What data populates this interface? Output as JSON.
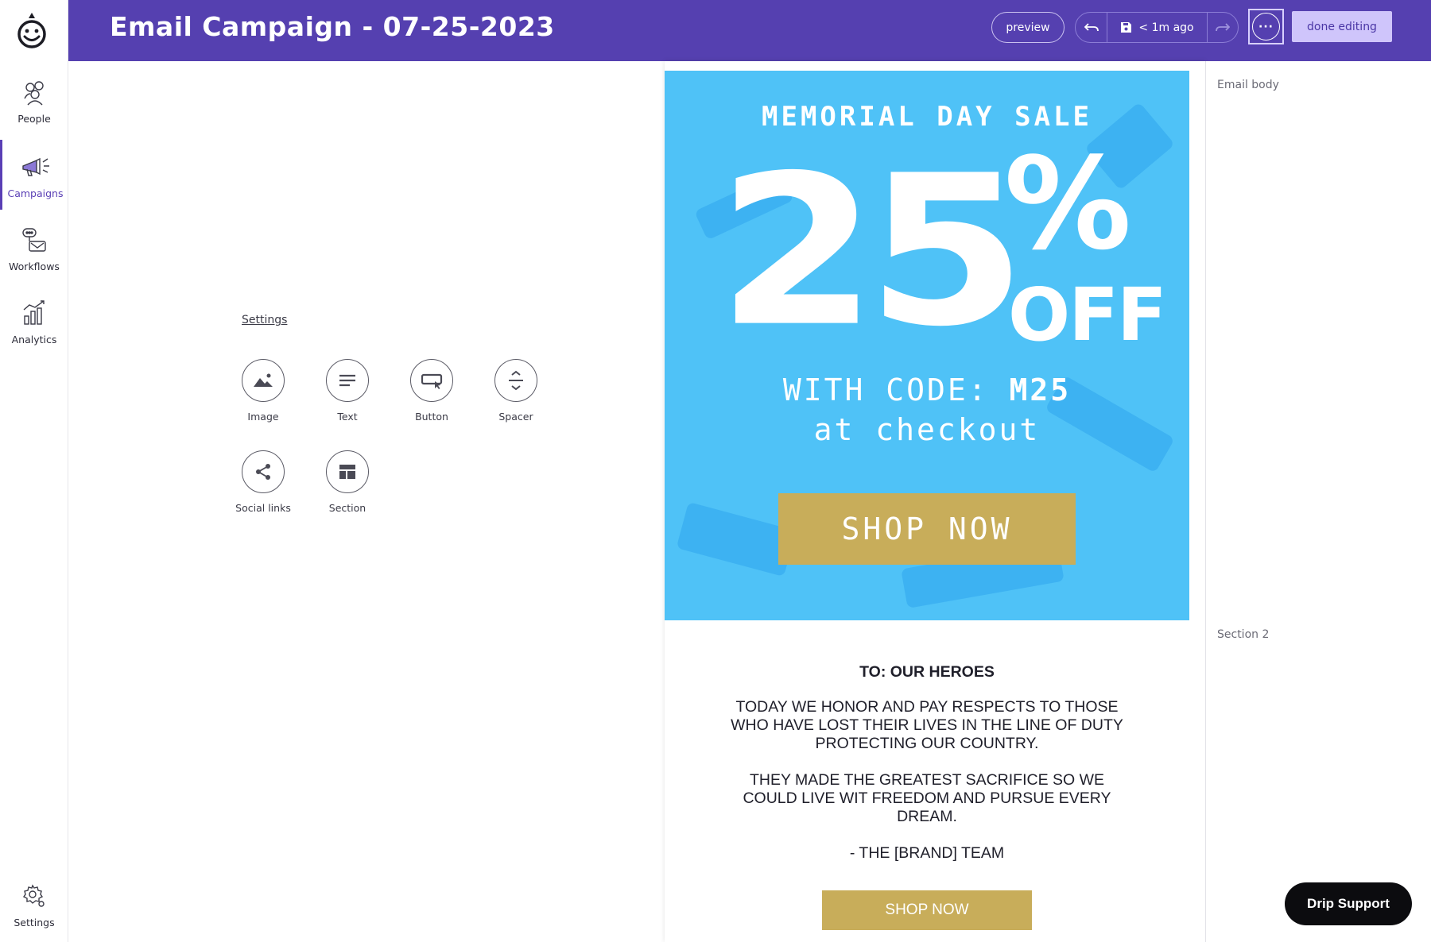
{
  "app": {
    "logo": "drip-smile-logo"
  },
  "nav": {
    "items": [
      {
        "label": "People",
        "icon": "people-icon"
      },
      {
        "label": "Campaigns",
        "icon": "megaphone-icon"
      },
      {
        "label": "Workflows",
        "icon": "workflow-icon"
      },
      {
        "label": "Analytics",
        "icon": "analytics-icon"
      }
    ],
    "settings_label": "Settings"
  },
  "header": {
    "title": "Email Campaign - 07-25-2023",
    "preview_label": "preview",
    "save_status": "< 1m ago",
    "more_label": "···",
    "done_label": "done editing",
    "colors": {
      "header_bg": "#5540b0",
      "done_bg": "#cfc5fb"
    }
  },
  "palette": {
    "settings_link": "Settings",
    "blocks": [
      {
        "label": "Image",
        "icon": "image-icon"
      },
      {
        "label": "Text",
        "icon": "text-icon"
      },
      {
        "label": "Button",
        "icon": "button-icon"
      },
      {
        "label": "Spacer",
        "icon": "spacer-icon"
      },
      {
        "label": "Social links",
        "icon": "share-icon"
      },
      {
        "label": "Section",
        "icon": "section-icon"
      }
    ]
  },
  "email": {
    "hero": {
      "subtitle": "MEMORIAL DAY SALE",
      "big_number": "25",
      "percent": "%",
      "off": "OFF",
      "code_prefix": "WITH CODE: ",
      "code": "M25",
      "checkout": "at checkout",
      "cta": "SHOP NOW",
      "colors": {
        "bg": "#4fc2f7",
        "cta": "#c8ad5a"
      }
    },
    "body": {
      "heading": "TO: OUR HEROES",
      "paragraph1": "TODAY WE HONOR AND PAY RESPECTS TO THOSE WHO HAVE LOST THEIR LIVES IN THE LINE OF DUTY PROTECTING OUR COUNTRY.",
      "paragraph2": "THEY MADE THE GREATEST SACRIFICE SO WE COULD LIVE WIT FREEDOM AND PURSUE EVERY DREAM.",
      "signoff": "- THE [BRAND] TEAM",
      "cta": "SHOP NOW"
    }
  },
  "right_panel": {
    "email_body_label": "Email body",
    "section2_label": "Section 2"
  },
  "support": {
    "label": "Drip Support"
  }
}
